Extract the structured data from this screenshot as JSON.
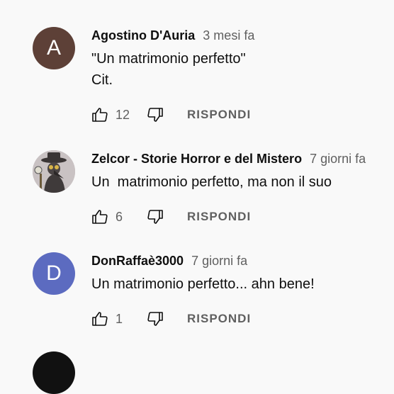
{
  "comments": [
    {
      "author": "Agostino D'Auria",
      "time": "3 mesi fa",
      "avatar_letter": "A",
      "avatar_color": "#5d4037",
      "text_lines": [
        "\"Un matrimonio perfetto\"",
        "Cit."
      ],
      "likes": "12",
      "reply_label": "RISPONDI"
    },
    {
      "author": "Zelcor - Storie Horror e del Mistero",
      "time": "7 giorni fa",
      "avatar_letter": "",
      "avatar_color": "#b7aeb0",
      "text_lines": [
        "Un  matrimonio perfetto, ma non il suo"
      ],
      "likes": "6",
      "reply_label": "RISPONDI"
    },
    {
      "author": "DonRaffaè3000",
      "time": "7 giorni fa",
      "avatar_letter": "D",
      "avatar_color": "#5c6bc0",
      "text_lines": [
        "Un matrimonio perfetto... ahn bene!"
      ],
      "likes": "1",
      "reply_label": "RISPONDI"
    }
  ],
  "icons": {
    "like": "thumb-up-icon",
    "dislike": "thumb-down-icon"
  }
}
